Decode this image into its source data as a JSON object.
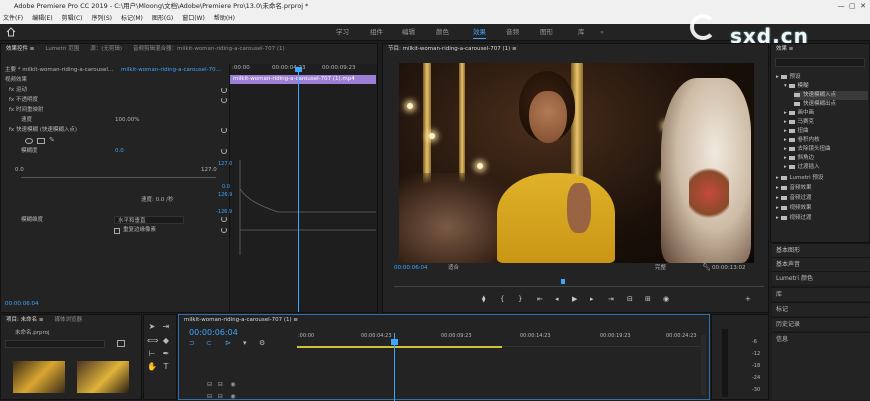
{
  "window": {
    "title": "Adobe Premiere Pro CC 2019 - C:\\用户\\Mloong\\文档\\Adobe\\Premiere Pro\\13.0\\未命名.prproj *"
  },
  "menu": [
    "文件(F)",
    "编辑(E)",
    "剪辑(C)",
    "序列(S)",
    "标记(M)",
    "图形(G)",
    "窗口(W)",
    "帮助(H)"
  ],
  "workspaces": [
    "学习",
    "组件",
    "编辑",
    "颜色",
    "效果",
    "音频",
    "图形",
    "库"
  ],
  "active_workspace": "效果",
  "watermark": "sxd.cn",
  "effect_controls": {
    "tabs": [
      "效果控件 ≡",
      "Lumetri 范围",
      "源：(无剪辑)",
      "音频剪辑混合器：milkit-woman-riding-a-carousel-707 (1)"
    ],
    "master_label": "主要 * milkit-woman-riding-a-carousel...",
    "clip_label": "milkit-woman-riding-a-carousel-70...",
    "time_start": ":00:00",
    "time_mid": "00:00:04:23",
    "time_end": "00:00:09:23",
    "clip_bar": "milkit-woman-riding-a-carousel-707 (1).mp4",
    "section": "视频效果",
    "rows": [
      "fx 运动",
      "fx 不透明度",
      "fx 时间重映射",
      "速度",
      "fx 快速模糊 (快速模糊入点)",
      "模糊度"
    ],
    "speed_value": "100.00%",
    "blur_value": "0.0",
    "graph_top": "127.0",
    "graph_zero": "0.0",
    "graph_max": "127.0",
    "graph_y1": "0.0",
    "graph_y2": "126.9",
    "graph_y3": "-126.9",
    "velocity_label": "速度: 0.0 /秒",
    "dimension_label": "模糊维度",
    "dimension_value": "水平和垂直",
    "repeat_label": "重复边缘像素",
    "timecode": "00:00:06:04"
  },
  "program": {
    "tab": "节目: milkit-woman-riding-a-carousel-707 (1) ≡",
    "timecode": "00:00:06:04",
    "fit": "适合",
    "quality": "完整",
    "duration": "00:00:13:02"
  },
  "project": {
    "tabs": [
      "项目: 未命名 ≡",
      "媒体浏览器"
    ],
    "file": "未命名.prproj"
  },
  "timeline": {
    "tab": "milkit-woman-riding-a-carousel-707 (1) ≡",
    "timecode": "00:00:06:04",
    "ticks": [
      ":00:00",
      "00:00:04:23",
      "00:00:09:23",
      "00:00:14:23",
      "00:00:19:23",
      "00:00:24:23",
      "00:00:29:23"
    ],
    "meter_labels": [
      "-6",
      "-12",
      "-18",
      "-24",
      "-30"
    ]
  },
  "effects_panel": {
    "title": "效果 ≡",
    "tree": [
      "预设",
      "模糊",
      "快速模糊入点",
      "快速模糊出点",
      "画中画",
      "马赛克",
      "扭曲",
      "卷积内核",
      "去除镜头扭曲",
      "斜角边",
      "过渡插入",
      "Lumetri 预设",
      "音频效果",
      "音频过渡",
      "视频效果",
      "视频过渡"
    ],
    "sections": [
      "基本图形",
      "基本声音",
      "Lumetri 颜色",
      "库",
      "标记",
      "历史记录",
      "信息"
    ]
  }
}
